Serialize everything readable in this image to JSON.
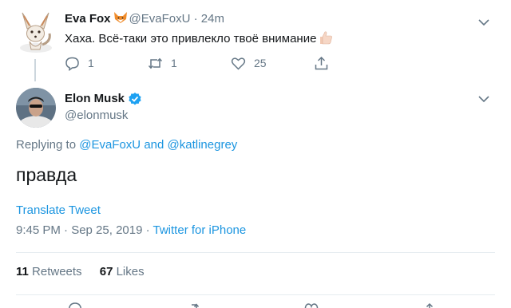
{
  "reply_tweet": {
    "name": "Eva Fox",
    "handle": "@EvaFoxU",
    "separator": "·",
    "time": "24m",
    "text": "Хаха. Всё-таки это привлекло твоё внимание",
    "actions": {
      "replies": "1",
      "retweets": "1",
      "likes": "25"
    }
  },
  "main_tweet": {
    "name": "Elon Musk",
    "handle": "@elonmusk",
    "replying_prefix": "Replying to",
    "replying_user1": "@EvaFoxU",
    "replying_and": "and",
    "replying_user2": "@katlinegrey",
    "text": "правда",
    "translate": "Translate Tweet",
    "timestamp": "9:45 PM · Sep 25, 2019",
    "meta_separator": "·",
    "source": "Twitter for iPhone",
    "retweets_count": "11",
    "retweets_label": "Retweets",
    "likes_count": "67",
    "likes_label": "Likes"
  },
  "colors": {
    "link": "#1b95e0",
    "secondary_text": "#657786",
    "divider": "#e6ecf0",
    "verified": "#1da1f2"
  }
}
